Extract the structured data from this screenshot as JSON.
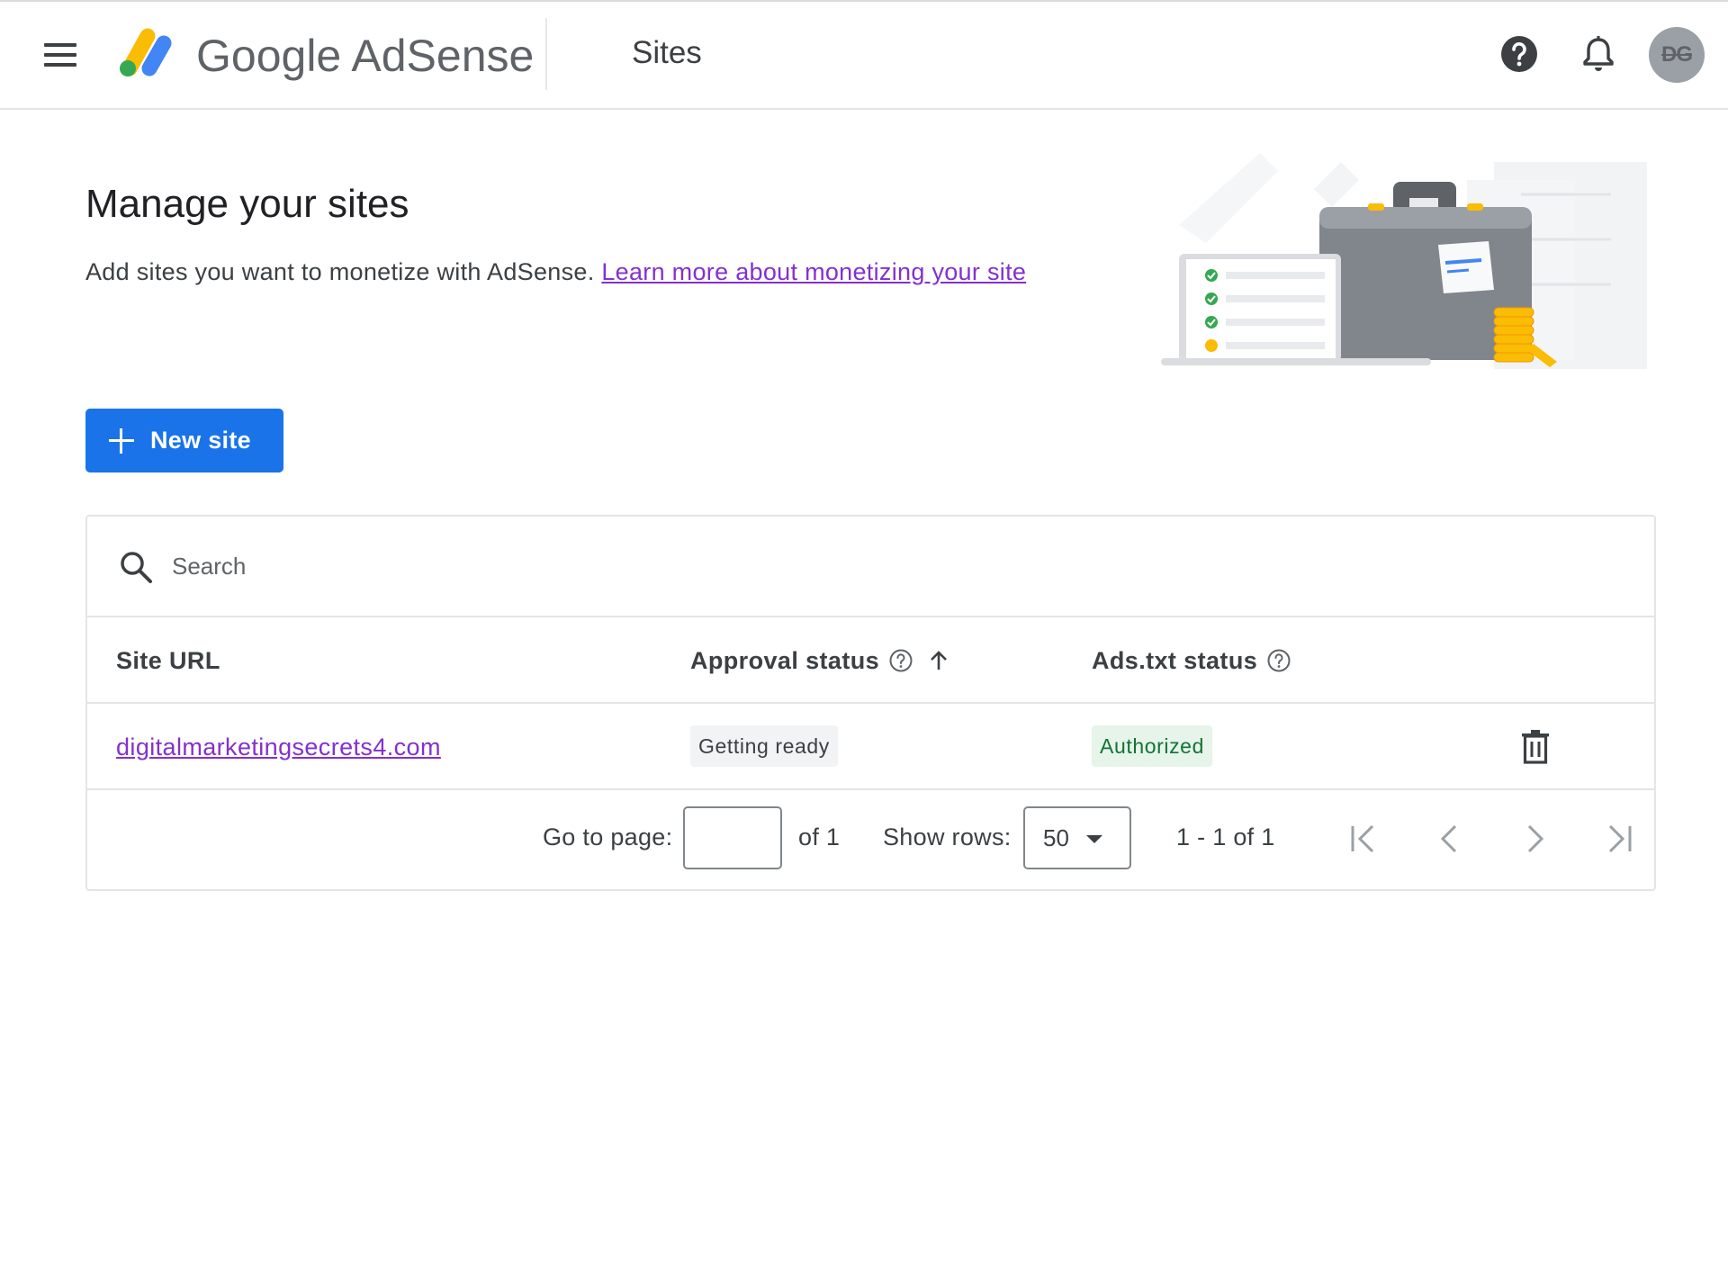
{
  "header": {
    "brand_google": "Google",
    "brand_product": "AdSense",
    "page_title": "Sites",
    "avatar_initials": "DG"
  },
  "intro": {
    "title": "Manage your sites",
    "description": "Add sites you want to monetize with AdSense.",
    "learn_more_link": "Learn more about monetizing your site"
  },
  "actions": {
    "new_site_label": "New site"
  },
  "search": {
    "placeholder": "Search",
    "value": ""
  },
  "table": {
    "columns": {
      "site_url": "Site URL",
      "approval_status": "Approval status",
      "ads_txt_status": "Ads.txt status"
    },
    "rows": [
      {
        "site_url": "digitalmarketingsecrets4.com",
        "approval_status": "Getting ready",
        "ads_txt_status": "Authorized"
      }
    ]
  },
  "pagination": {
    "go_to_page_label": "Go to page:",
    "page_value": "",
    "of_pages": "of 1",
    "show_rows_label": "Show rows:",
    "rows_per_page": "50",
    "range_text": "1 - 1 of 1"
  },
  "colors": {
    "primary": "#1a73e8",
    "link": "#8430ce",
    "authorized_bg": "#e6f4ea",
    "authorized_text": "#137333",
    "chip_bg": "#f1f3f4"
  },
  "icons": {
    "menu": "menu-icon",
    "help": "help-icon",
    "notifications": "bell-icon",
    "search": "search-icon",
    "delete": "trash-icon",
    "sort": "arrow-up-icon"
  }
}
